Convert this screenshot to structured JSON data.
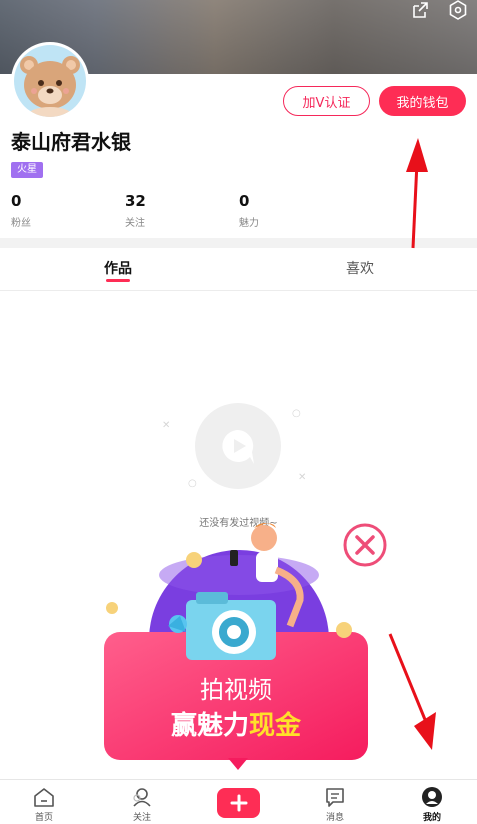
{
  "profile": {
    "username": "泰山府君水银",
    "badge": "火星",
    "verify_button": "加V认证",
    "wallet_button": "我的钱包",
    "stats": [
      {
        "value": "0",
        "label": "粉丝"
      },
      {
        "value": "32",
        "label": "关注"
      },
      {
        "value": "0",
        "label": "魅力"
      }
    ]
  },
  "tabs": [
    {
      "label": "作品",
      "active": true
    },
    {
      "label": "喜欢",
      "active": false
    }
  ],
  "empty_state": {
    "text": "还没有发过视频~"
  },
  "promo": {
    "line1": "拍视频",
    "line2_prefix": "赢魅力",
    "line2_highlight": "现金"
  },
  "bottom_nav": {
    "home": "首页",
    "follow": "关注",
    "messages": "消息",
    "me": "我的"
  },
  "colors": {
    "accent": "#fe2d55",
    "badge": "#a070f0",
    "arrow": "#e8101a"
  },
  "icons": [
    "share-icon",
    "settings-icon",
    "empty-video-icon",
    "close-circle-icon",
    "home-icon",
    "follow-icon",
    "add-icon",
    "message-icon",
    "me-icon"
  ]
}
